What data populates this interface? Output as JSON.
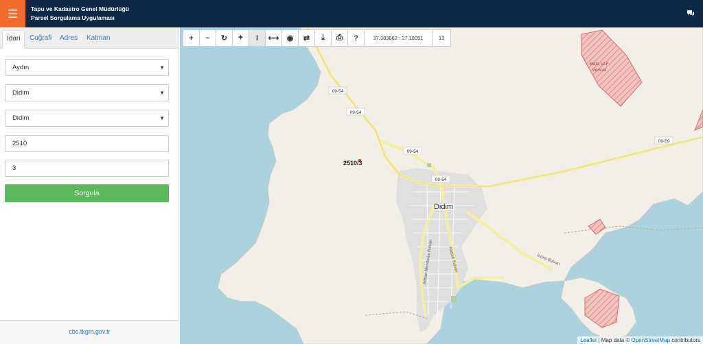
{
  "header": {
    "menu_icon": "hamburger-icon",
    "title_line1": "Tapu ve Kadastro Genel Müdürlüğü",
    "title_line2": "Parsel Sorgulama Uygulaması",
    "chat_icon": "comments-icon"
  },
  "sidebar": {
    "tabs": [
      {
        "label": "İdari",
        "active": true
      },
      {
        "label": "Coğrafi"
      },
      {
        "label": "Adres"
      },
      {
        "label": "Katman"
      }
    ],
    "il": "Aydın",
    "ilce": "Didim",
    "mahalle": "Didim",
    "ada": "2510",
    "parsel": "3",
    "submit": "Sorgula",
    "footer": "cbs.tkgm.gov.tr"
  },
  "map": {
    "toolbar": {
      "coords": "37.383662 : 27.18051",
      "zoom": "13"
    },
    "labels": {
      "town": "Didim",
      "parcel": "2510/3",
      "road1": "09-54",
      "road2": "09-59",
      "bafa": "Bafa VLF",
      "vericisi": "Vericisi",
      "inonu": "İnönü Bulvarı",
      "adnan": "Adnan Menderes Bulvarı",
      "ataturk": "Atatürk Bulvarı"
    },
    "attribution": {
      "leaflet": "Leaflet",
      "mapdata": " | Map data © ",
      "osm": "OpenStreetMap",
      "contrib": " contributors"
    }
  },
  "colors": {
    "header": "#0e2a47",
    "menu": "#f26b2a",
    "submit": "#5cb85c",
    "water": "#aad3df",
    "land": "#f2efe9"
  }
}
